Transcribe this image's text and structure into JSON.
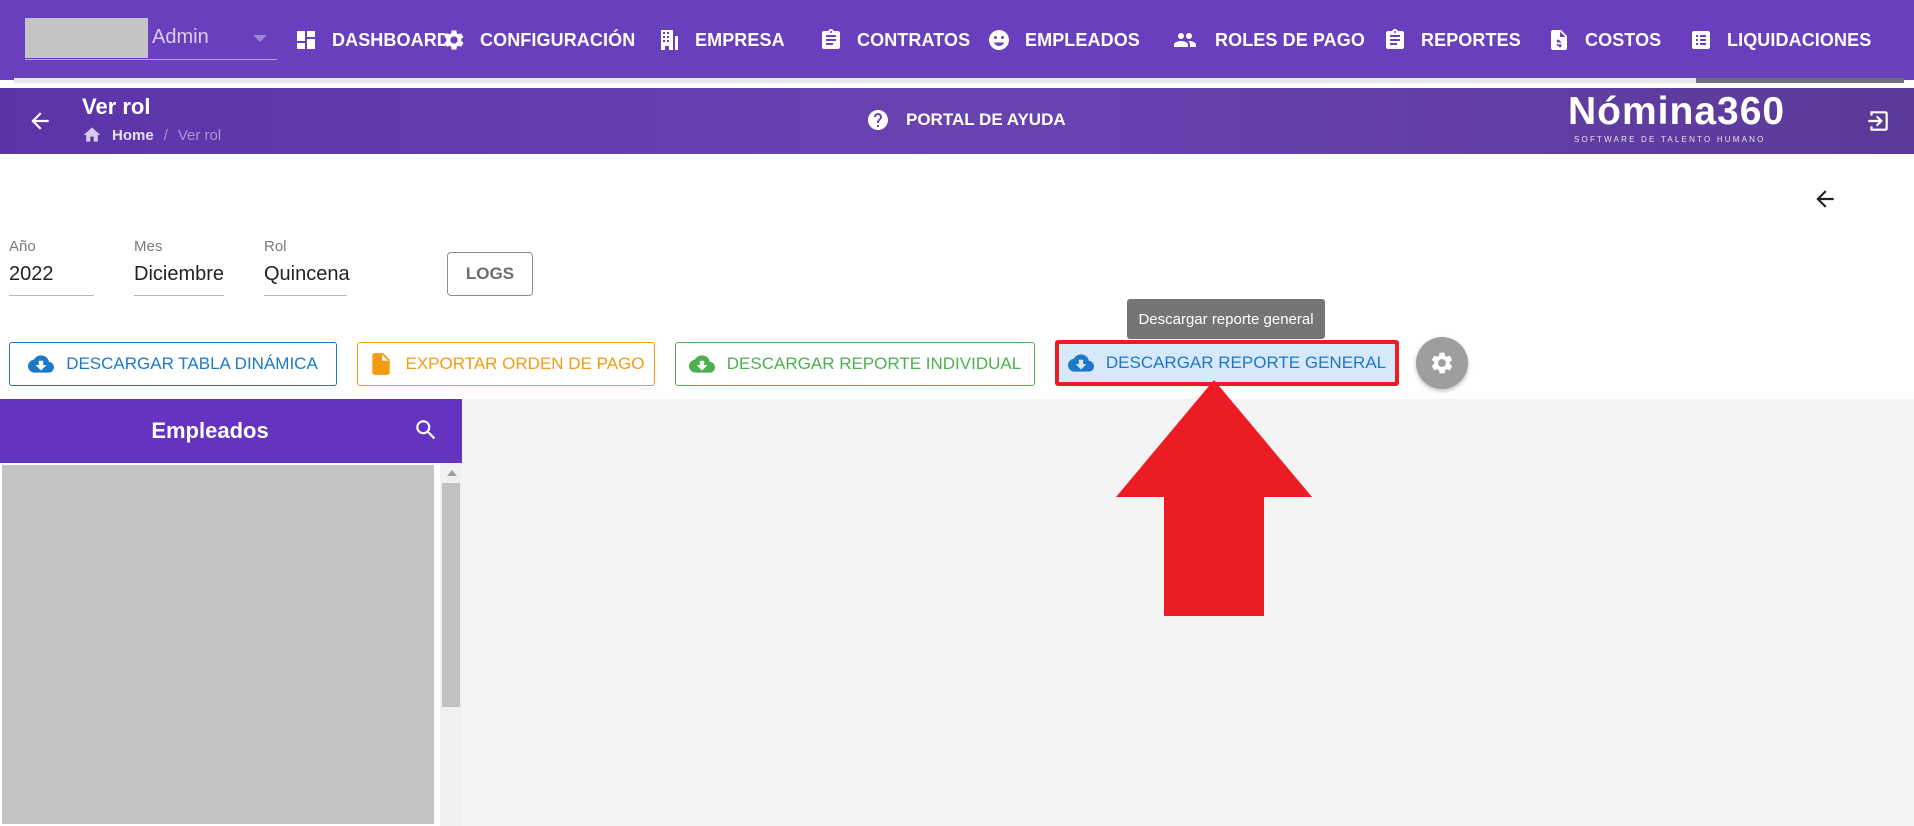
{
  "app": {
    "user": {
      "name": "Admin"
    },
    "nav": [
      {
        "label": "DASHBOARD",
        "icon": "dashboard-icon"
      },
      {
        "label": "CONFIGURACIÓN",
        "icon": "gear-icon"
      },
      {
        "label": "EMPRESA",
        "icon": "building-icon"
      },
      {
        "label": "CONTRATOS",
        "icon": "clipboard-icon"
      },
      {
        "label": "EMPLEADOS",
        "icon": "face-icon"
      },
      {
        "label": "ROLES DE PAGO",
        "icon": "group-icon"
      },
      {
        "label": "REPORTES",
        "icon": "clipboard-icon"
      },
      {
        "label": "COSTOS",
        "icon": "invoice-icon"
      },
      {
        "label": "LIQUIDACIONES",
        "icon": "list-icon"
      }
    ],
    "progress": 0.89,
    "colors": {
      "primary": "#6a3fbd",
      "accent_blue": "#1e78c8",
      "orange": "#f39c12",
      "green": "#4caf50",
      "annotation_red": "#ec1c24"
    }
  },
  "header": {
    "title": "Ver rol",
    "breadcrumb": {
      "home": "Home",
      "separator": "/",
      "current": "Ver rol"
    },
    "help": "PORTAL DE AYUDA",
    "logo": {
      "main": "Nómina360",
      "sub": "SOFTWARE DE TALENTO HUMANO"
    }
  },
  "filters": {
    "year": {
      "label": "Año",
      "value": "2022"
    },
    "month": {
      "label": "Mes",
      "value": "Diciembre"
    },
    "role": {
      "label": "Rol",
      "value": "Quincena"
    },
    "logs_label": "LOGS"
  },
  "actions": {
    "tabla": "DESCARGAR TABLA DINÁMICA",
    "orden": "EXPORTAR ORDEN DE PAGO",
    "individual": "DESCARGAR REPORTE INDIVIDUAL",
    "general": "DESCARGAR REPORTE GENERAL",
    "tooltip": "Descargar reporte general"
  },
  "employees": {
    "title": "Empleados"
  }
}
